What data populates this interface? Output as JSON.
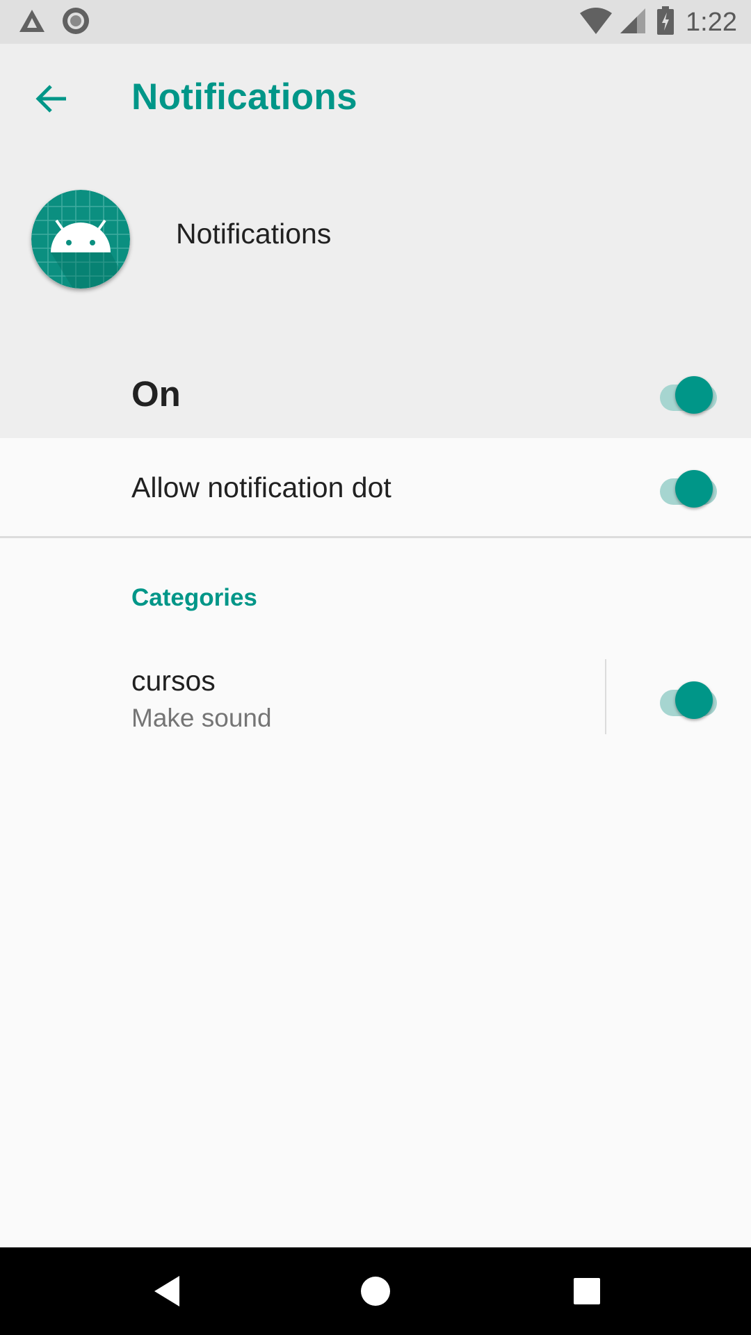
{
  "status_bar": {
    "time": "1:22",
    "left_icons": [
      "warning-triangle-icon",
      "sync-circle-icon"
    ],
    "right_icons": [
      "wifi-icon",
      "signal-icon",
      "battery-charging-icon"
    ]
  },
  "toolbar": {
    "title": "Notifications",
    "back_icon": "arrow-back-icon"
  },
  "app": {
    "name": "Notifications",
    "icon": "android-app-icon"
  },
  "master_switch": {
    "label": "On",
    "checked": true
  },
  "notification_dot": {
    "label": "Allow notification dot",
    "checked": true
  },
  "categories": {
    "header": "Categories",
    "channels": [
      {
        "title": "cursos",
        "summary": "Make sound",
        "checked": true
      }
    ]
  },
  "nav_bar": {
    "buttons": [
      "back-triangle-icon",
      "home-circle-icon",
      "recents-square-icon"
    ]
  },
  "colors": {
    "accent": "#009688",
    "accent_track": "#a6d5d0",
    "header_bg": "#eeeeee",
    "status_bg": "#e0e0e0"
  }
}
